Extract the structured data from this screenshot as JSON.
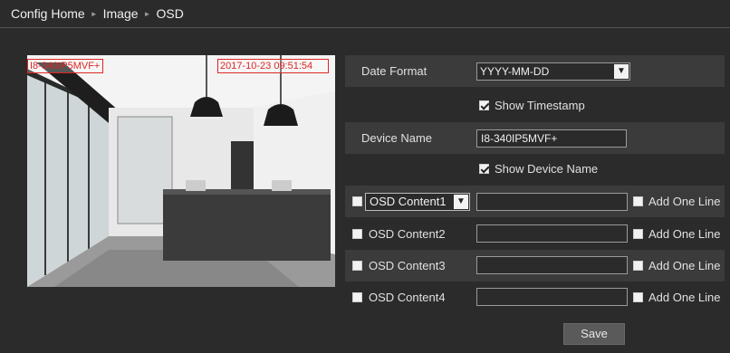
{
  "breadcrumb": {
    "items": [
      "Config Home",
      "Image",
      "OSD"
    ],
    "separator": "►"
  },
  "preview": {
    "osd_device_name": "I8-340IP5MVF+",
    "osd_timestamp": "2017-10-23 09:51:54",
    "overlay_color": "#e02424"
  },
  "form": {
    "date_format": {
      "label": "Date Format",
      "value": "YYYY-MM-DD"
    },
    "show_timestamp": {
      "label": "Show Timestamp",
      "checked": true
    },
    "device_name": {
      "label": "Device Name",
      "value": "I8-340IP5MVF+"
    },
    "show_device_name": {
      "label": "Show Device Name",
      "checked": true
    },
    "osd_rows": [
      {
        "label": "OSD Content1",
        "is_select": true,
        "checked": false,
        "value": "",
        "add_one_line": "Add One Line"
      },
      {
        "label": "OSD Content2",
        "is_select": false,
        "checked": false,
        "value": "",
        "add_one_line": "Add One Line"
      },
      {
        "label": "OSD Content3",
        "is_select": false,
        "checked": false,
        "value": "",
        "add_one_line": "Add One Line"
      },
      {
        "label": "OSD Content4",
        "is_select": false,
        "checked": false,
        "value": "",
        "add_one_line": "Add One Line"
      }
    ]
  },
  "save_label": "Save"
}
